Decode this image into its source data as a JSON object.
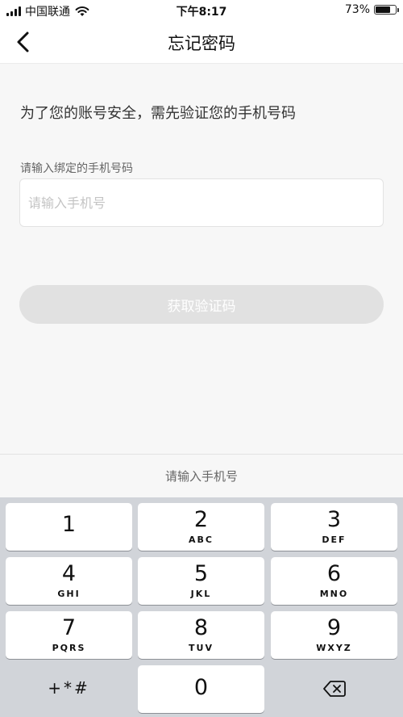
{
  "status_bar": {
    "carrier": "中国联通",
    "time": "下午8:17",
    "battery_percent": "73%",
    "battery_level": 0.73,
    "signal_icon": "signal-bars-icon",
    "wifi_icon": "wifi-icon",
    "battery_icon": "battery-icon"
  },
  "nav": {
    "title": "忘记密码",
    "back_icon": "chevron-left-icon"
  },
  "form": {
    "prompt": "为了您的账号安全，需先验证您的手机号码",
    "phone_label": "请输入绑定的手机号码",
    "phone_placeholder": "请输入手机号",
    "phone_value": "",
    "get_code_label": "获取验证码"
  },
  "keyboard": {
    "header": "请输入手机号",
    "keys": [
      {
        "digit": "1",
        "letters": ""
      },
      {
        "digit": "2",
        "letters": "ABC"
      },
      {
        "digit": "3",
        "letters": "DEF"
      },
      {
        "digit": "4",
        "letters": "GHI"
      },
      {
        "digit": "5",
        "letters": "JKL"
      },
      {
        "digit": "6",
        "letters": "MNO"
      },
      {
        "digit": "7",
        "letters": "PQRS"
      },
      {
        "digit": "8",
        "letters": "TUV"
      },
      {
        "digit": "9",
        "letters": "WXYZ"
      },
      {
        "digit": "0",
        "letters": ""
      }
    ],
    "symbols_key": "+*#",
    "delete_icon": "backspace-icon"
  },
  "colors": {
    "background": "#f7f7f7",
    "button_disabled": "#e1e1e1",
    "keyboard_bg": "#d1d4d9"
  }
}
